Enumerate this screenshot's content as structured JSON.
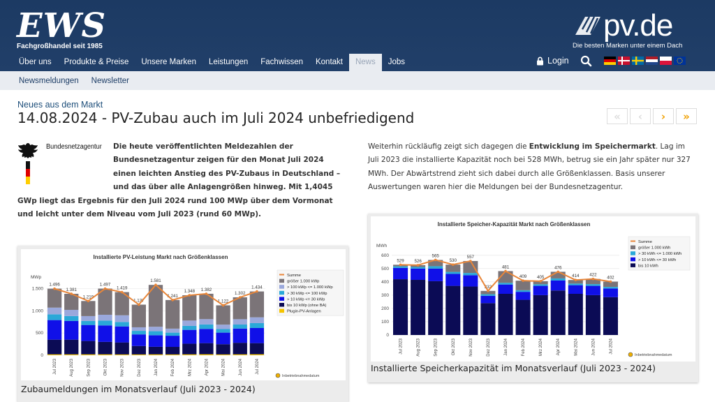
{
  "header": {
    "logo_main": "EWS",
    "logo_sub": "Fachgroßhandel seit 1985",
    "pv_logo": "pv.de",
    "pv_tagline": "Die besten Marken unter einem Dach",
    "login": "Login",
    "colors": {
      "bar": "#1c3a63",
      "accent": "#f0a000",
      "subnav": "#e9ecf1"
    }
  },
  "nav": [
    "Über uns",
    "Produkte & Preise",
    "Unsere Marken",
    "Leistungen",
    "Fachwissen",
    "Kontakt",
    "News",
    "Jobs"
  ],
  "nav_active": "News",
  "subnav": [
    "Newsmeldungen",
    "Newsletter"
  ],
  "flags": [
    "de-flag",
    "dk-flag",
    "se-flag",
    "nl-flag",
    "pl-flag",
    "eu-flag"
  ],
  "article": {
    "category": "Neues aus dem Markt",
    "title": "14.08.2024 - PV-Zubau auch im Juli 2024 unbefriedigend",
    "pager": [
      "«",
      "‹",
      "›",
      "»"
    ],
    "agency": "Bundesnetzagentur",
    "lead": "Die heute veröffentlichten Meldezahlen der Bundesnetzagentur zeigen für den Monat Juli 2024 einen leichten Anstieg des PV-Zubaus in Deutschland – und das über alle Anlagengrößen hinweg. Mit 1,4045 GWp liegt das Ergebnis für den Juli 2024 rund 100 MWp über dem Vormonat und leicht unter dem Niveau vom Juli 2023 (rund 60 MWp).",
    "para2_a": "Weiterhin rückläufig zeigt sich dagegen die ",
    "para2_b": "Entwicklung im Speichermarkt",
    "para2_c": ". Lag im Juli 2023 die installierte Kapazität noch bei 528 MWh, betrug sie ein Jahr später nur 327 MWh. Der Abwärtstrend zieht sich dabei durch alle Größenklassen. Basis unserer Auswertungen waren hier die Meldungen bei der Bundesnetzagentur.",
    "caption1": "Zubaumeldungen im Monatsverlauf (Juli 2023 - 2024)",
    "caption2": "Installierte Speicherkapazität im Monatsverlauf (Juli 2023 - 2024)"
  },
  "chart_data": [
    {
      "type": "bar",
      "title": "Installierte PV-Leistung Markt nach Größenklassen",
      "ylabel": "MWp",
      "ylim": [
        0,
        1600
      ],
      "yticks": [
        "0",
        "500",
        "1.000",
        "1.500"
      ],
      "footnote": "Inbetriebnahmedatum",
      "categories": [
        "Jul 2023",
        "Aug 2023",
        "Sep 2023",
        "Okt 2023",
        "Nov 2023",
        "Dez 2023",
        "Jan 2024",
        "Feb 2024",
        "Mrz 2024",
        "Apr 2024",
        "Mai 2024",
        "Jun 2024",
        "Jul 2024"
      ],
      "total_labels": [
        "1.496",
        "1.381",
        "1.219",
        "1.497",
        "1.419",
        "1.137",
        "1.581",
        "1.241",
        "1.348",
        "1.382",
        "1.122",
        "1.302",
        "1.434"
      ],
      "series": [
        {
          "name": "Plugin-PV-Anlagen",
          "color": "#f5c400",
          "values": [
            20,
            20,
            20,
            20,
            18,
            18,
            20,
            18,
            20,
            22,
            18,
            20,
            22
          ]
        },
        {
          "name": "bis 10 kWp (ohne BA)",
          "color": "#0b0b55",
          "values": [
            330,
            330,
            300,
            280,
            270,
            190,
            170,
            170,
            240,
            250,
            230,
            260,
            250
          ]
        },
        {
          "name": "> 10 kWp <= 30 kWp",
          "color": "#1010e8",
          "values": [
            440,
            420,
            360,
            370,
            360,
            260,
            260,
            250,
            310,
            320,
            260,
            320,
            340
          ]
        },
        {
          "name": "> 30 kWp <= 100 kWp",
          "color": "#2aa8d8",
          "values": [
            130,
            110,
            90,
            110,
            100,
            80,
            90,
            70,
            90,
            100,
            80,
            90,
            110
          ]
        },
        {
          "name": "> 100 kWp <= 1.000 kWp",
          "color": "#9aa8dc",
          "values": [
            150,
            140,
            110,
            130,
            150,
            80,
            100,
            90,
            120,
            120,
            100,
            120,
            130
          ]
        },
        {
          "name": "größer 1.000 kWp",
          "color": "#7b7478",
          "values": [
            426,
            361,
            339,
            587,
            521,
            509,
            941,
            643,
            568,
            570,
            434,
            492,
            582
          ]
        },
        {
          "name": "Summe",
          "color": "#e8863a",
          "values": [
            1496,
            1381,
            1219,
            1497,
            1419,
            1137,
            1581,
            1241,
            1348,
            1382,
            1122,
            1302,
            1434
          ]
        }
      ]
    },
    {
      "type": "bar",
      "title": "Installierte Speicher-Kapazität Markt nach Größenklassen",
      "ylabel": "MWh",
      "ylim": [
        0,
        620
      ],
      "yticks": [
        "0",
        "100",
        "200",
        "300",
        "400",
        "500",
        "600"
      ],
      "footnote": "Inbetriebnahmedatum",
      "categories": [
        "Jul 2023",
        "Aug 2023",
        "Sep 2023",
        "Okt 2023",
        "Nov 2023",
        "Dez 2023",
        "Jan 2024",
        "Feb 2024",
        "Mrz 2024",
        "Apr 2024",
        "Mai 2024",
        "Jun 2024",
        "Jul 2024"
      ],
      "total_labels": [
        "529",
        "526",
        "565",
        "530",
        "557",
        "332",
        "481",
        "409",
        "405",
        "476",
        "414",
        "422",
        "402"
      ],
      "series": [
        {
          "name": "bis 10 kWh",
          "color": "#0b0b55",
          "values": [
            420,
            415,
            405,
            370,
            365,
            240,
            310,
            265,
            300,
            335,
            310,
            300,
            285
          ]
        },
        {
          "name": "> 10 kWh <= 30 kWh",
          "color": "#1010e8",
          "values": [
            85,
            85,
            95,
            90,
            85,
            55,
            70,
            60,
            70,
            75,
            65,
            70,
            65
          ]
        },
        {
          "name": "> 30 kWh <= 1.000 kWh",
          "color": "#2aa8d8",
          "values": [
            12,
            12,
            18,
            15,
            17,
            12,
            13,
            12,
            12,
            16,
            12,
            13,
            12
          ]
        },
        {
          "name": "größer 1.000 kWh",
          "color": "#7b7478",
          "values": [
            12,
            14,
            47,
            55,
            90,
            25,
            88,
            72,
            23,
            50,
            27,
            39,
            40
          ]
        },
        {
          "name": "Summe",
          "color": "#e8863a",
          "values": [
            529,
            526,
            565,
            530,
            557,
            332,
            481,
            409,
            405,
            476,
            414,
            422,
            402
          ]
        }
      ]
    }
  ]
}
